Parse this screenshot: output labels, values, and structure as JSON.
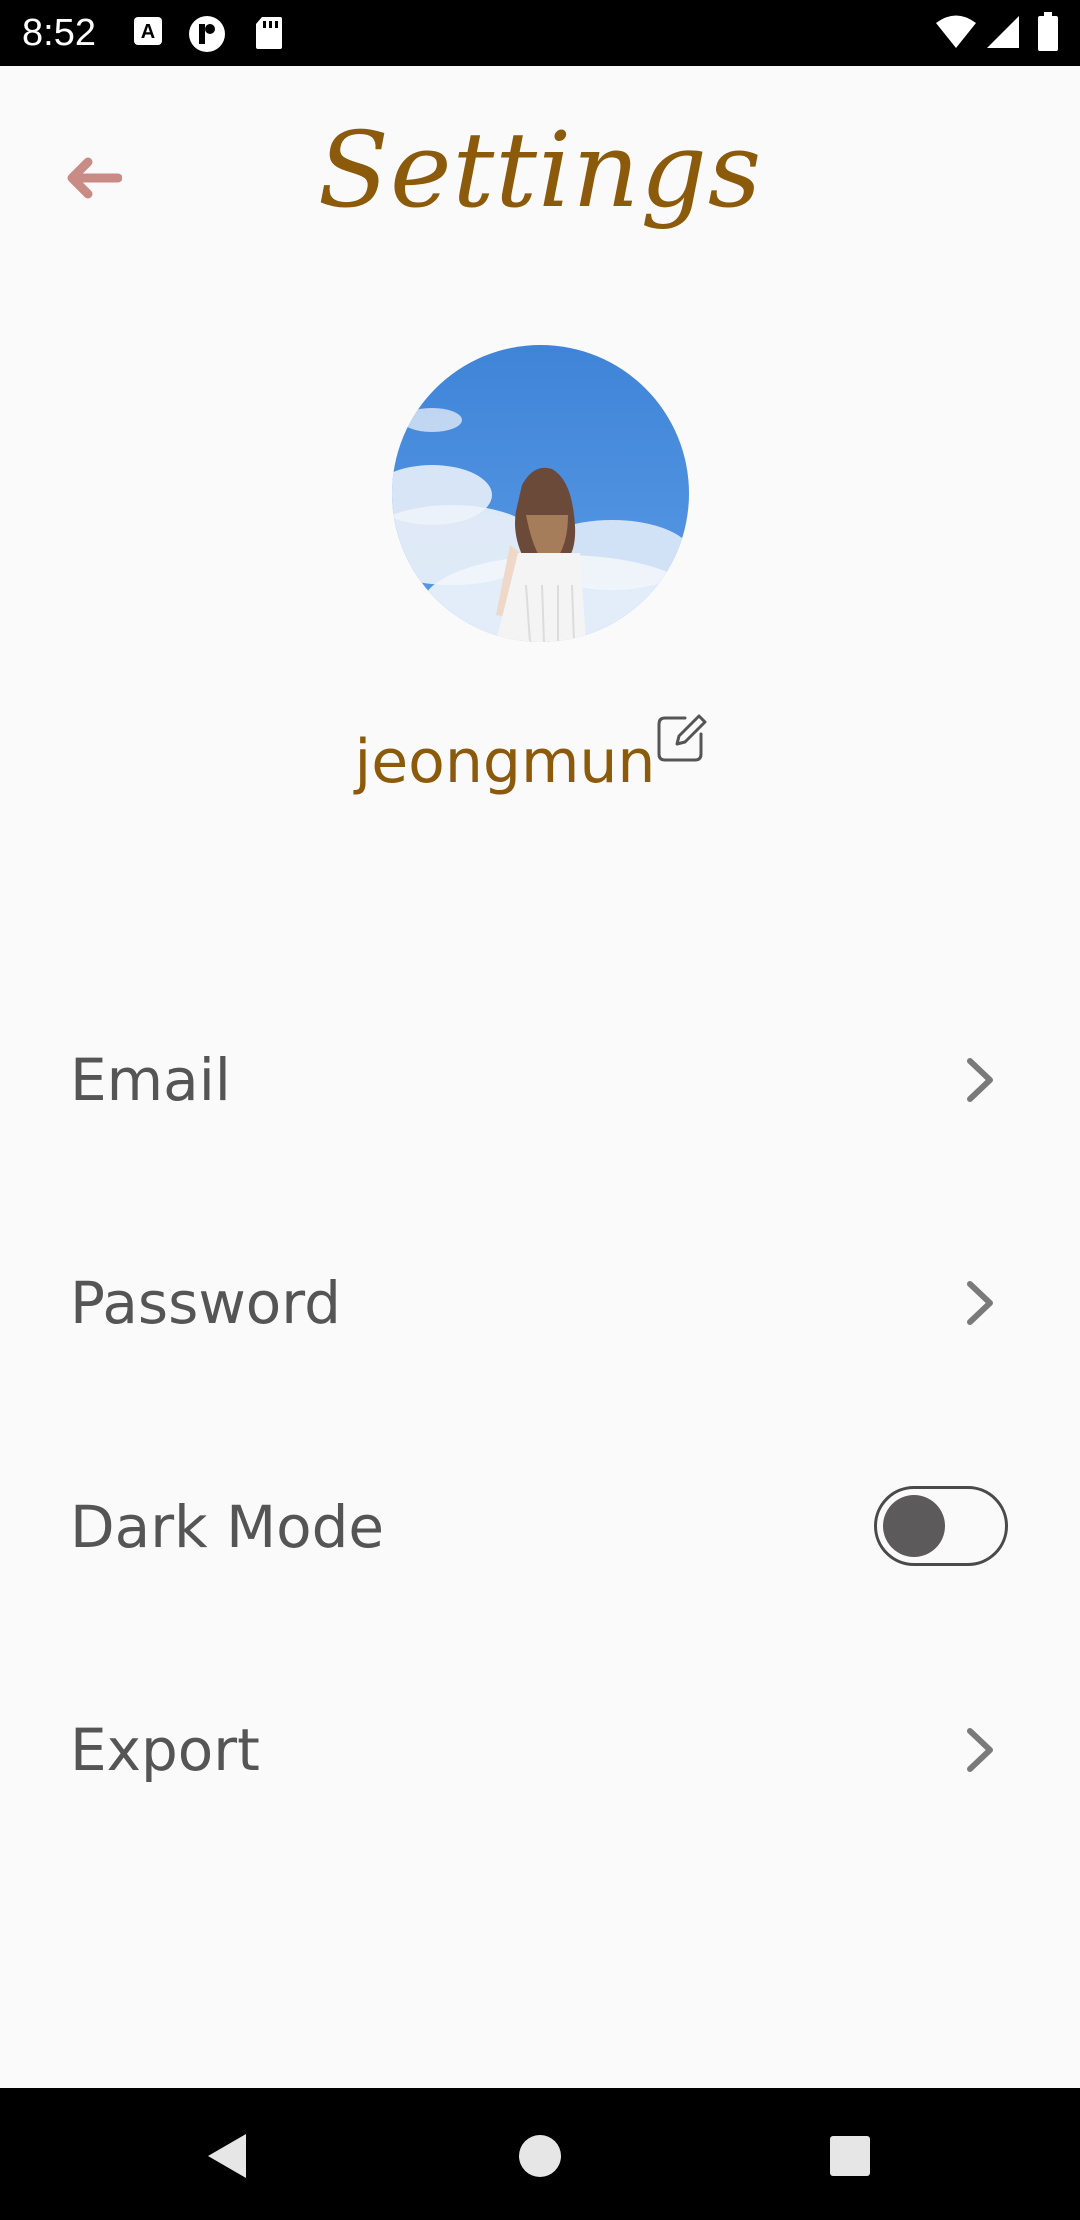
{
  "status_bar": {
    "time": "8:52",
    "icons": [
      "a-notification-icon",
      "p-notification-icon",
      "sd-card-icon",
      "wifi-icon",
      "signal-icon",
      "battery-icon"
    ]
  },
  "header": {
    "title": "Settings",
    "back_icon": "arrow-left-icon",
    "back_color": "#c98b85",
    "title_color": "#8b5a0a"
  },
  "profile": {
    "username": "jeongmun",
    "edit_icon": "edit-icon",
    "avatar_desc_icon": "avatar-photo"
  },
  "settings": {
    "items": [
      {
        "label": "Email",
        "control": "chevron-right-icon"
      },
      {
        "label": "Password",
        "control": "chevron-right-icon"
      },
      {
        "label": "Dark Mode",
        "control": "toggle",
        "value": false
      },
      {
        "label": "Export",
        "control": "chevron-right-icon"
      }
    ]
  },
  "nav_bar": {
    "buttons": [
      "back-triangle-icon",
      "home-circle-icon",
      "recents-square-icon"
    ]
  }
}
